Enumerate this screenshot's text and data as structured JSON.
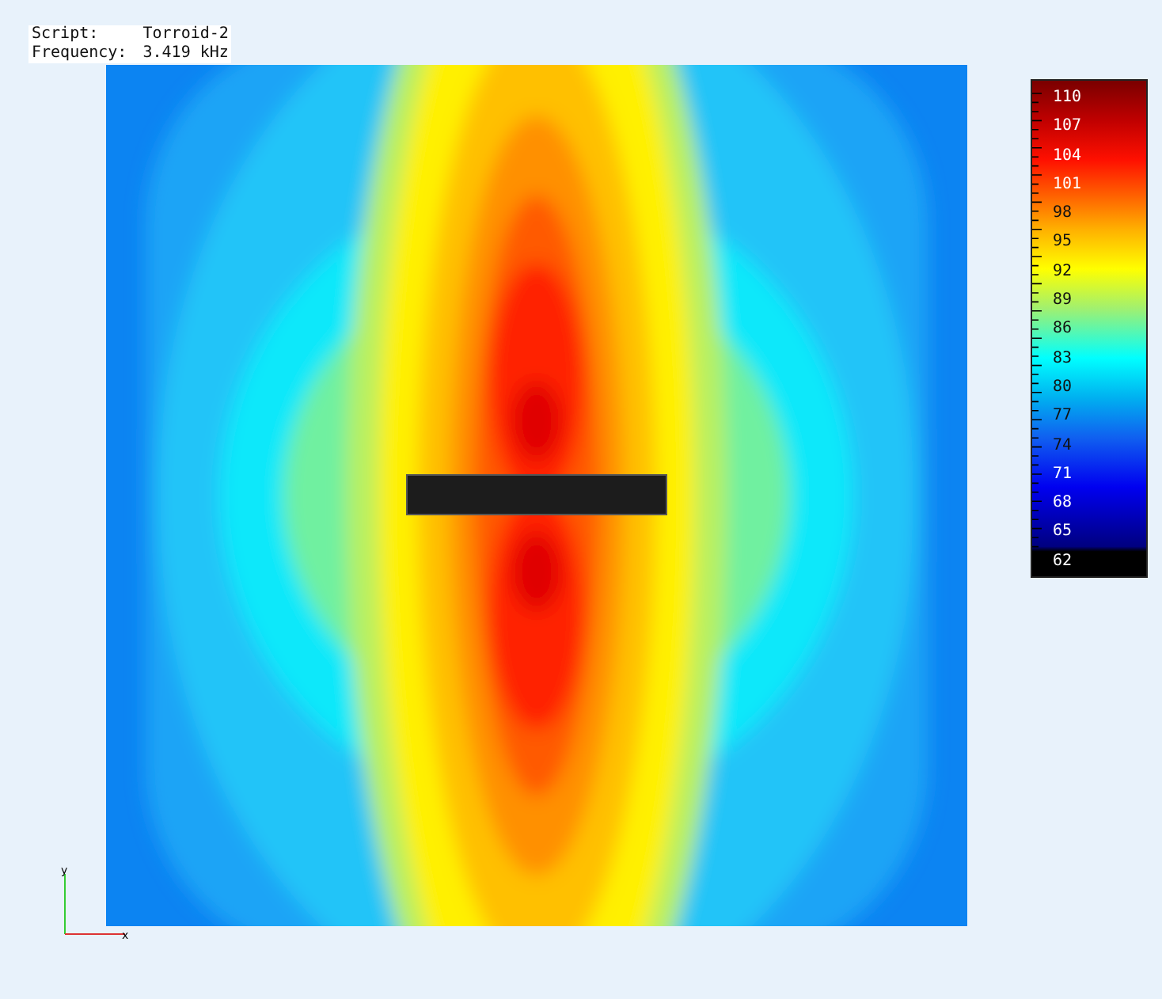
{
  "info": [
    {
      "label": "Script:",
      "value": "Torroid-2"
    },
    {
      "label": "Frequency:",
      "value": "3.419 kHz"
    }
  ],
  "legend": {
    "labels": [
      "110",
      "107",
      "104",
      "101",
      "98",
      "95",
      "92",
      "89",
      "86",
      "83",
      "80",
      "77",
      "74",
      "71",
      "68",
      "65",
      "62"
    ]
  },
  "axes": {
    "x": "x",
    "y": "y"
  }
}
